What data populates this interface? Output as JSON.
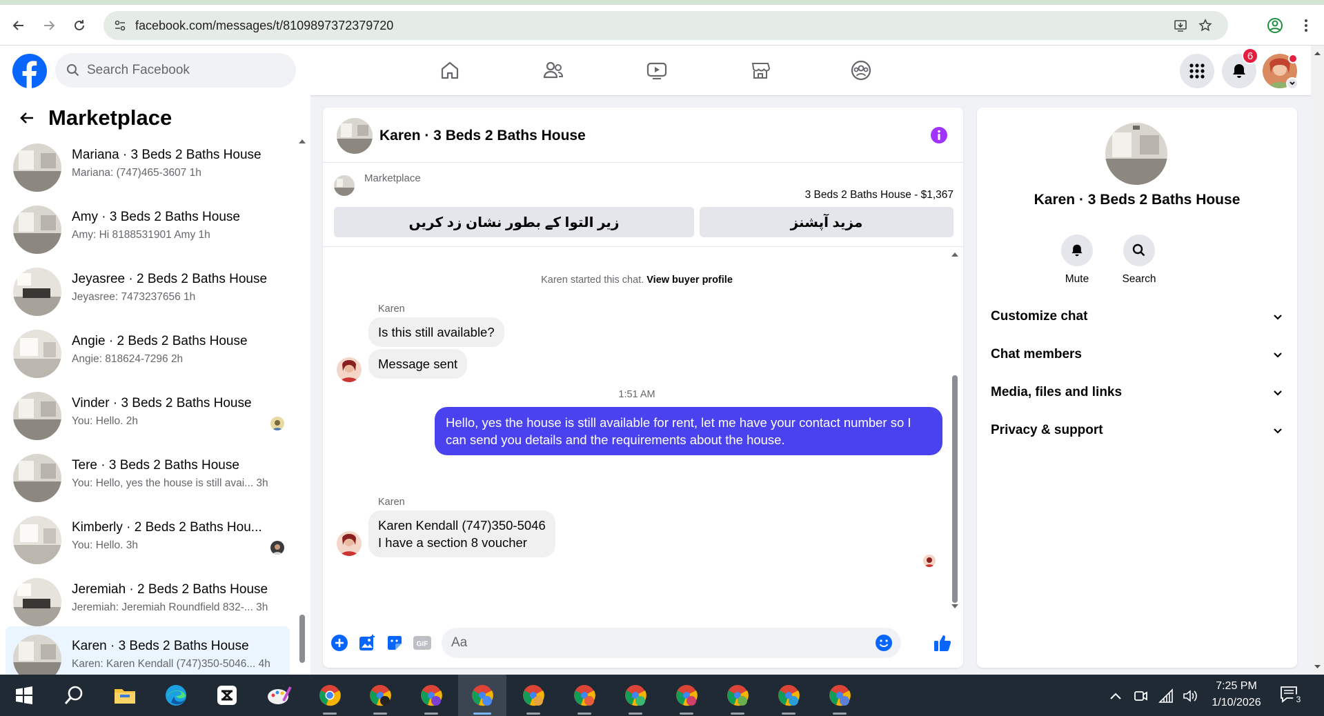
{
  "browser": {
    "url": "facebook.com/messages/t/8109897372379720"
  },
  "header": {
    "search_placeholder": "Search Facebook",
    "notification_count": "6"
  },
  "sidebar": {
    "title": "Marketplace",
    "conversations": [
      {
        "title": "Mariana · 3 Beds 2 Baths House",
        "preview": "Mariana: (747)465-3607",
        "time": "1h"
      },
      {
        "title": "Amy · 3 Beds 2 Baths House",
        "preview": "Amy: Hi 8188531901 Amy",
        "time": "1h"
      },
      {
        "title": "Jeyasree · 2 Beds 2 Baths House",
        "preview": "Jeyasree: 7473237656",
        "time": "1h"
      },
      {
        "title": "Angie · 2 Beds 2 Baths House",
        "preview": "Angie: 818624-7296",
        "time": "2h"
      },
      {
        "title": "Vinder · 3 Beds 2 Baths House",
        "preview": "You: Hello.",
        "time": "2h"
      },
      {
        "title": "Tere · 3 Beds 2 Baths House",
        "preview": "You: Hello, yes the house is still avai...",
        "time": "3h"
      },
      {
        "title": "Kimberly · 2 Beds 2 Baths Hou...",
        "preview": "You: Hello.",
        "time": "3h"
      },
      {
        "title": "Jeremiah · 2 Beds 2 Baths House",
        "preview": "Jeremiah: Jeremiah Roundfield 832-...",
        "time": "3h"
      },
      {
        "title": "Karen · 3 Beds 2 Baths House",
        "preview": "Karen: Karen Kendall (747)350-5046...",
        "time": "4h"
      }
    ]
  },
  "chat": {
    "title": "Karen · 3 Beds 2 Baths House",
    "marketplace_label": "Marketplace",
    "listing_price": "3 Beds 2 Baths House - $1,367",
    "btn_mark_pending": "زیر التوا کے بطور نشان زد کریں",
    "btn_more_options": "مزید آپشنز",
    "system_started": "Karen started this chat.",
    "system_link": "View buyer profile",
    "sender_name": "Karen",
    "msg_1": "Is this still available?",
    "msg_2": "Message sent",
    "timestamp": "1:51 AM",
    "msg_out_line1": "Hello, yes the house is still available for rent, let me have your contact number so I",
    "msg_out_line2": "can send you details and the requirements about the house.",
    "sender_name_2": "Karen",
    "msg_3_line1": "Karen Kendall (747)350-5046",
    "msg_3_line2": "I have a section 8 voucher",
    "composer_placeholder": "Aa"
  },
  "info_panel": {
    "name": "Karen · 3 Beds 2 Baths House",
    "mute_label": "Mute",
    "search_label": "Search",
    "sections": [
      "Customize chat",
      "Chat members",
      "Media, files and links",
      "Privacy & support"
    ]
  },
  "taskbar": {
    "time": "7:25 PM",
    "date": "1/10/2026",
    "notification_count": "3"
  },
  "colors": {
    "fb_blue": "#0866ff",
    "outgoing_bubble": "#4a42ee",
    "badge_red": "#e41e3f",
    "info_purple": "#a033ff"
  }
}
